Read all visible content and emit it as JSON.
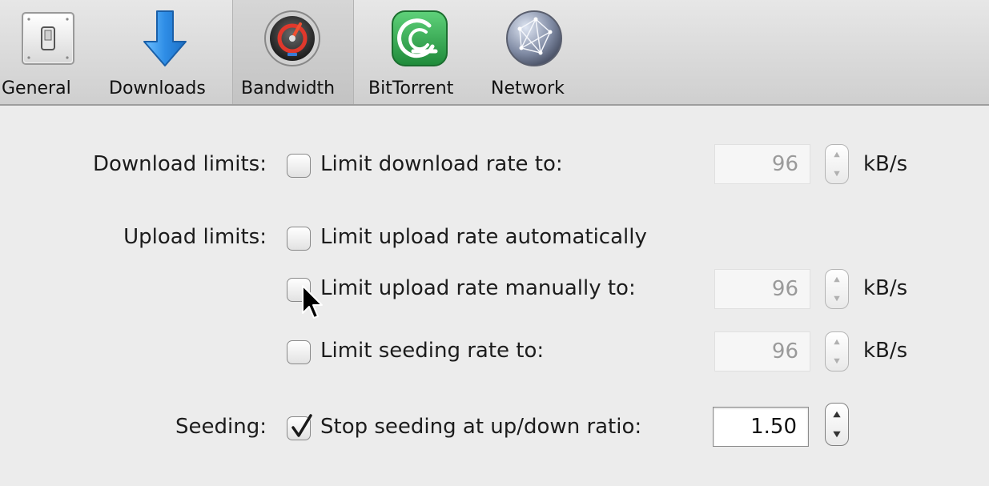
{
  "toolbar": {
    "items": [
      {
        "label": "General",
        "icon": "toggle-switch-icon"
      },
      {
        "label": "Downloads",
        "icon": "download-arrow-icon"
      },
      {
        "label": "Bandwidth",
        "icon": "speedometer-icon",
        "selected": true
      },
      {
        "label": "BitTorrent",
        "icon": "bittorrent-logo-icon"
      },
      {
        "label": "Network",
        "icon": "globe-network-icon"
      }
    ]
  },
  "bandwidth": {
    "download": {
      "section_label": "Download limits:",
      "option_label": "Limit download rate to:",
      "checked": false,
      "value": "96",
      "unit": "kB/s"
    },
    "upload": {
      "section_label": "Upload limits:",
      "auto_label": "Limit upload rate automatically",
      "auto_checked": false,
      "manual_label": "Limit upload rate manually to:",
      "manual_checked": false,
      "manual_value": "96",
      "manual_unit": "kB/s",
      "seeding_rate_label": "Limit seeding rate to:",
      "seeding_rate_checked": false,
      "seeding_rate_value": "96",
      "seeding_rate_unit": "kB/s"
    },
    "seeding": {
      "section_label": "Seeding:",
      "option_label": "Stop seeding at up/down ratio:",
      "checked": true,
      "ratio_value": "1.50"
    }
  },
  "colors": {
    "toolbar_bg": "#d8d8d8",
    "window_bg": "#ececec",
    "download_arrow": "#2e8de6",
    "bittorrent_green": "#2aa84a"
  }
}
